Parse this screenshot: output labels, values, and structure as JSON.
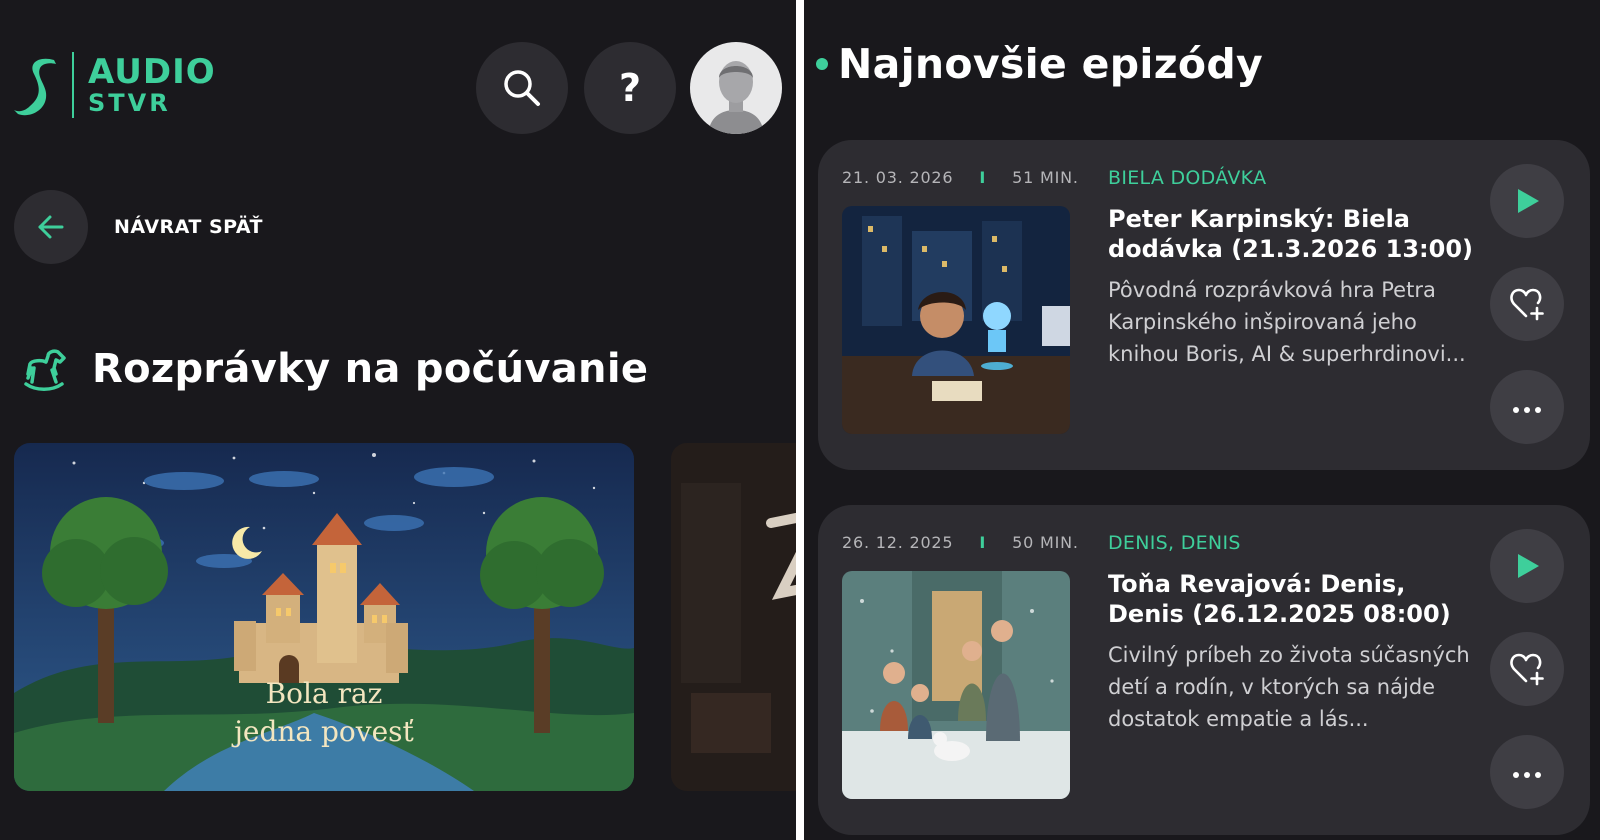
{
  "header": {
    "logo_line1": "AUDIO",
    "logo_line2": "STVR",
    "help_label": "?"
  },
  "back": {
    "label": "NÁVRAT SPÄŤ"
  },
  "section": {
    "title": "Rozprávky na počúvanie",
    "featured_card": {
      "title_line1": "Bola raz",
      "title_line2": "jedna povesť"
    }
  },
  "episodes_section": {
    "title": "Najnovšie epizódy",
    "items": [
      {
        "date": "21. 03. 2026",
        "separator": "I",
        "duration": "51 MIN.",
        "show": "BIELA DODÁVKA",
        "title": "Peter Karpinský: Biela dodávka (21.3.2026 13:00)",
        "description": "Pôvodná rozprávková hra Petra Karpinského inšpirovaná jeho knihou Boris, AI & superhrdinovi..."
      },
      {
        "date": "26. 12. 2025",
        "separator": "I",
        "duration": "50 MIN.",
        "show": "DENIS, DENIS",
        "title": "Toňa Revajová: Denis, Denis (26.12.2025 08:00)",
        "description": "Civilný príbeh zo života súčasných detí a rodín, v ktorých sa nájde dostatok empatie a lás..."
      }
    ]
  },
  "colors": {
    "accent": "#3ecf9b",
    "background": "#19181c",
    "card": "#2d2c31",
    "button": "#3f3e44"
  },
  "icons": [
    "logo-mark-icon",
    "search-icon",
    "help-icon",
    "avatar-icon",
    "arrow-left-icon",
    "rocking-horse-icon",
    "play-icon",
    "heart-plus-icon",
    "more-icon"
  ]
}
